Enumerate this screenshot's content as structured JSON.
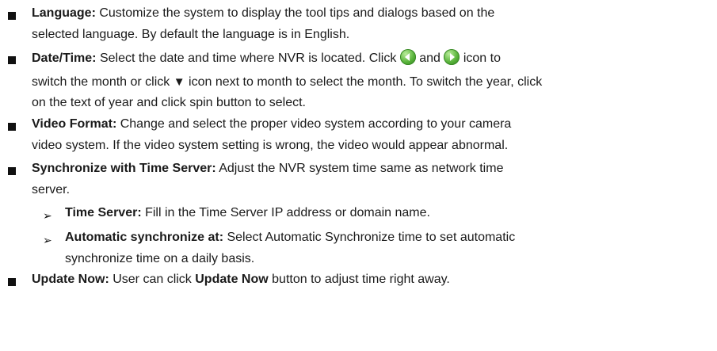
{
  "items": [
    {
      "term": "Language:",
      "line1": " Customize the system to display the tool tips and dialogs based on the",
      "line2": "selected language. By default the language is in English."
    },
    {
      "term": "Date/Time:",
      "line1_a": " Select the date and time where NVR is located. Click ",
      "line1_b": " and ",
      "line1_c": " icon to",
      "icons": [
        "prev-arrow-icon",
        "next-arrow-icon"
      ],
      "line2_a": "switch the month or click ",
      "triangle": "▼",
      "line2_b": " icon next to month to select the month. To switch the year, click",
      "line3": "on the text of year and click spin button to select."
    },
    {
      "term": "Video Format:",
      "line1": " Change and select the proper video system according to your camera",
      "line2": "video system. If the video system setting is wrong, the video would appear abnormal."
    },
    {
      "term": "Synchronize with Time Server:",
      "line1": " Adjust the NVR system time same as network time",
      "line2": "server."
    },
    {
      "term": "Update Now:",
      "line1_a": " User can click ",
      "line1_bold": "Update Now",
      "line1_b": " button to adjust time right away."
    }
  ],
  "subitems": [
    {
      "term": "Time Server:",
      "line1": " Fill in the Time Server IP address or domain name."
    },
    {
      "term": "Automatic synchronize at:",
      "line1": " Select Automatic Synchronize time to set automatic",
      "line2": "synchronize time on a daily basis."
    }
  ],
  "icon_color": "#58b33a"
}
